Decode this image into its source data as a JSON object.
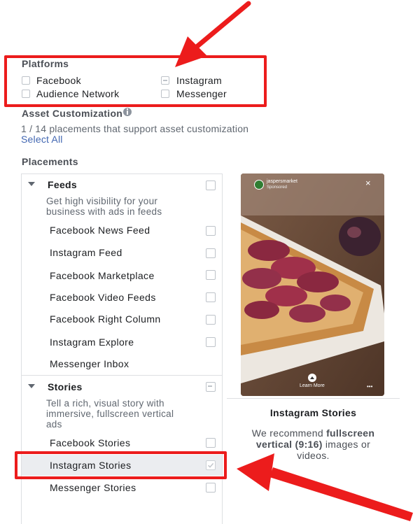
{
  "platforms": {
    "title": "Platforms",
    "options": [
      "Facebook",
      "Instagram",
      "Audience Network",
      "Messenger"
    ]
  },
  "asset_customization": {
    "title": "Asset Customization",
    "info_icon": "info-icon",
    "summary": "1 / 14 placements that support asset customization",
    "select_all": "Select All"
  },
  "placements": {
    "title": "Placements",
    "feeds": {
      "title": "Feeds",
      "description_lines": [
        "Get high visibility for your",
        "business with ads in feeds"
      ],
      "items": [
        "Facebook News Feed",
        "Instagram Feed",
        "Facebook Marketplace",
        "Facebook Video Feeds",
        "Facebook Right Column",
        "Instagram Explore",
        "Messenger Inbox"
      ]
    },
    "stories": {
      "title": "Stories",
      "description_lines": [
        "Tell a rich, visual story with",
        "immersive, fullscreen vertical",
        "ads"
      ],
      "items": [
        "Facebook Stories",
        "Instagram Stories",
        "Messenger Stories"
      ]
    }
  },
  "preview": {
    "account_name": "jaspersmarket",
    "sponsored": "Sponsored",
    "cta": "Learn More",
    "title": "Instagram Stories",
    "recommend_prefix": "We recommend ",
    "recommend_bold_1": "fullscreen",
    "recommend_bold_2": "vertical (9:16)",
    "recommend_suffix_1": " images or",
    "recommend_suffix_2": "videos."
  },
  "colors": {
    "annotation_red": "#ec1c1c",
    "link_blue": "#4267b2",
    "selected_row_bg": "#ebedf0"
  }
}
